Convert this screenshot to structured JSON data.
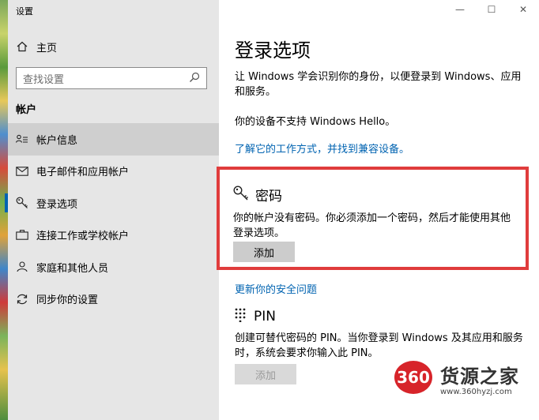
{
  "window": {
    "title": "设置",
    "minimize": "—",
    "maximize": "☐",
    "close": "✕"
  },
  "sidebar": {
    "home_label": "主页",
    "search_placeholder": "查找设置",
    "section_header": "帐户",
    "items": [
      {
        "label": "帐户信息",
        "icon": "user-info-icon",
        "active": true
      },
      {
        "label": "电子邮件和应用帐户",
        "icon": "mail-icon"
      },
      {
        "label": "登录选项",
        "icon": "key-icon",
        "selected": true
      },
      {
        "label": "连接工作或学校帐户",
        "icon": "briefcase-icon"
      },
      {
        "label": "家庭和其他人员",
        "icon": "people-icon"
      },
      {
        "label": "同步你的设置",
        "icon": "sync-icon"
      }
    ]
  },
  "main": {
    "title": "登录选项",
    "intro": "让 Windows 学会识别你的身份，以便登录到 Windows、应用和服务。",
    "no_hello": "你的设备不支持 Windows Hello。",
    "learn_link": "了解它的工作方式，并找到兼容设备。",
    "password": {
      "title": "密码",
      "description": "你的帐户没有密码。你必须添加一个密码，然后才能使用其他登录选项。",
      "add_label": "添加"
    },
    "security_link": "更新你的安全问题",
    "pin": {
      "title": "PIN",
      "description": "创建可替代密码的 PIN。当你登录到 Windows 及其应用和服务时，系统会要求你输入此 PIN。",
      "add_label": "添加"
    }
  },
  "watermark": {
    "badge": "360",
    "name": "货源之家",
    "url": "www.360hyzj.com"
  },
  "colors": {
    "accent": "#0063b1",
    "highlight_box": "#e03c3c",
    "sidebar_bg": "#e6e6e6"
  }
}
